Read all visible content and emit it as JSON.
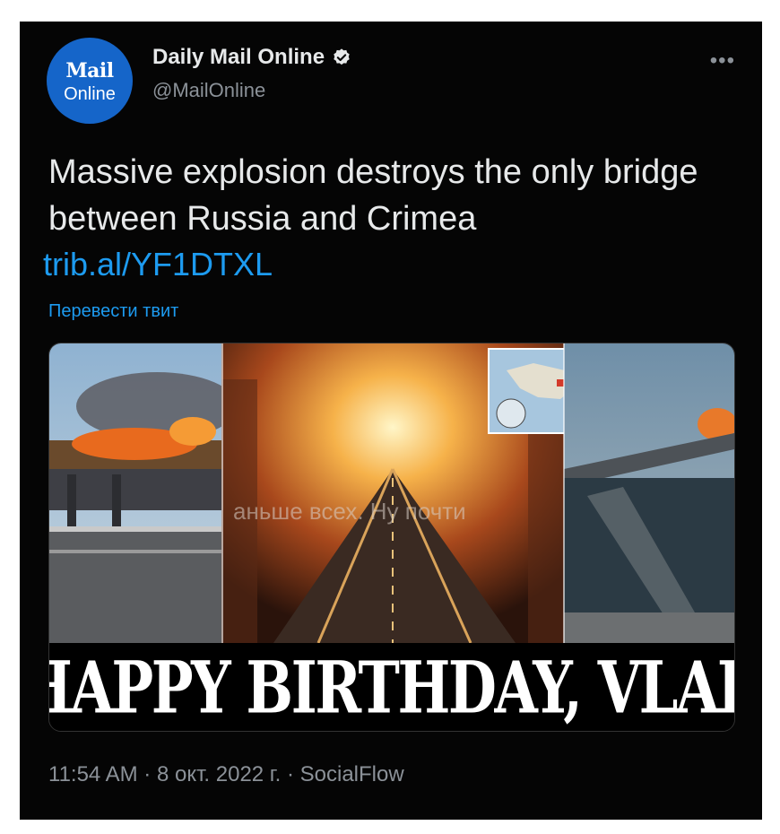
{
  "account": {
    "avatar_top": "Mail",
    "avatar_bottom": "Online",
    "name": "Daily Mail Online",
    "handle": "@MailOnline",
    "verified_icon": "verified-badge-icon",
    "more_icon": "more-dots-icon",
    "more_glyph": "•••"
  },
  "tweet": {
    "text": "Massive explosion destroys the only bridge between Russia and Crimea",
    "link": "trib.al/YF1DTXL",
    "translate": "Перевести твит"
  },
  "media": {
    "overlay_text": "аньше всех. Ну почти",
    "headline": "HAPPY BIRTHDAY, VLAD"
  },
  "footer": {
    "meta": "11:54 AM · 8 окт. 2022 г. · SocialFlow"
  },
  "colors": {
    "background": "#050505",
    "link": "#1d9bf0",
    "avatar": "#1565c9"
  }
}
